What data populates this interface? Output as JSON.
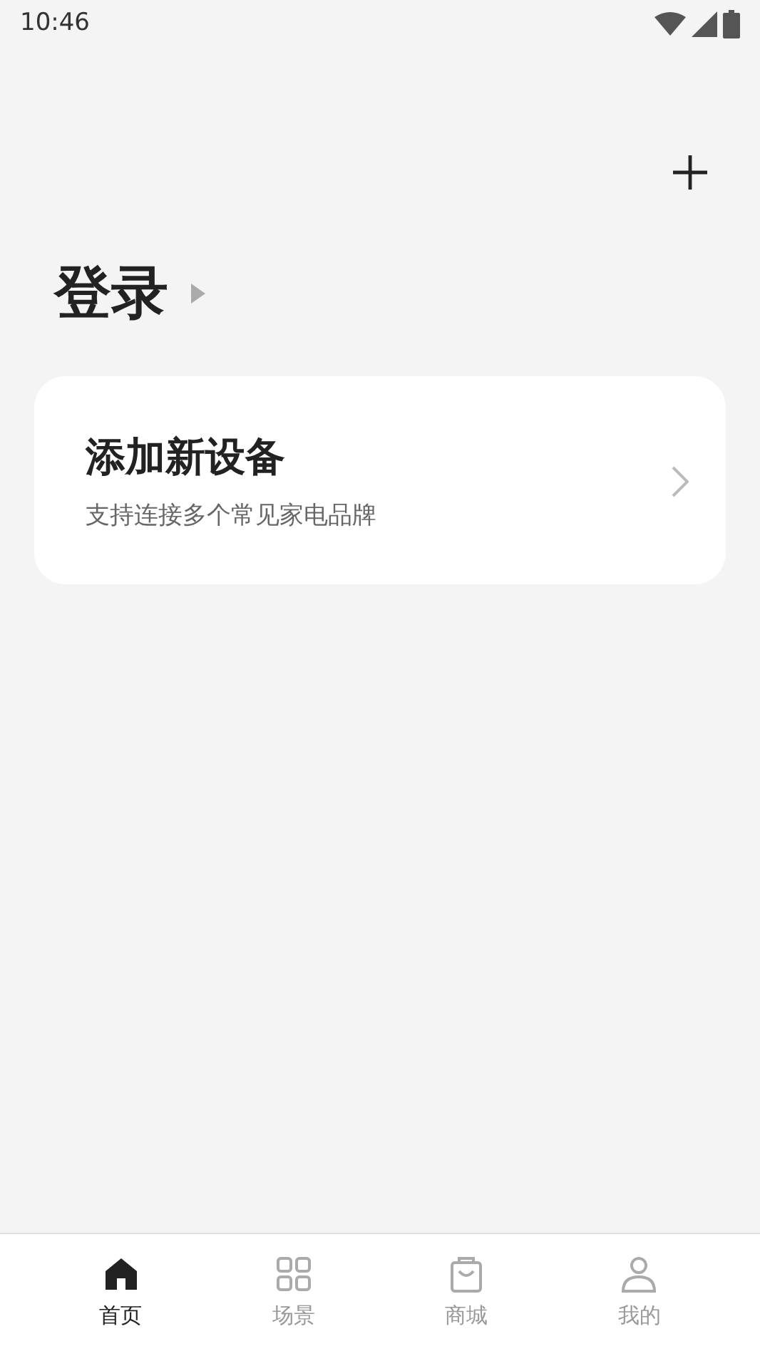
{
  "status_bar": {
    "time": "10:46"
  },
  "login": {
    "title": "登录"
  },
  "card": {
    "title": "添加新设备",
    "subtitle": "支持连接多个常见家电品牌"
  },
  "tabs": [
    {
      "label": "首页",
      "kind": "home",
      "selected": true
    },
    {
      "label": "场景",
      "kind": "grid",
      "selected": false
    },
    {
      "label": "商城",
      "kind": "bag",
      "selected": false
    },
    {
      "label": "我的",
      "kind": "person",
      "selected": false
    }
  ]
}
